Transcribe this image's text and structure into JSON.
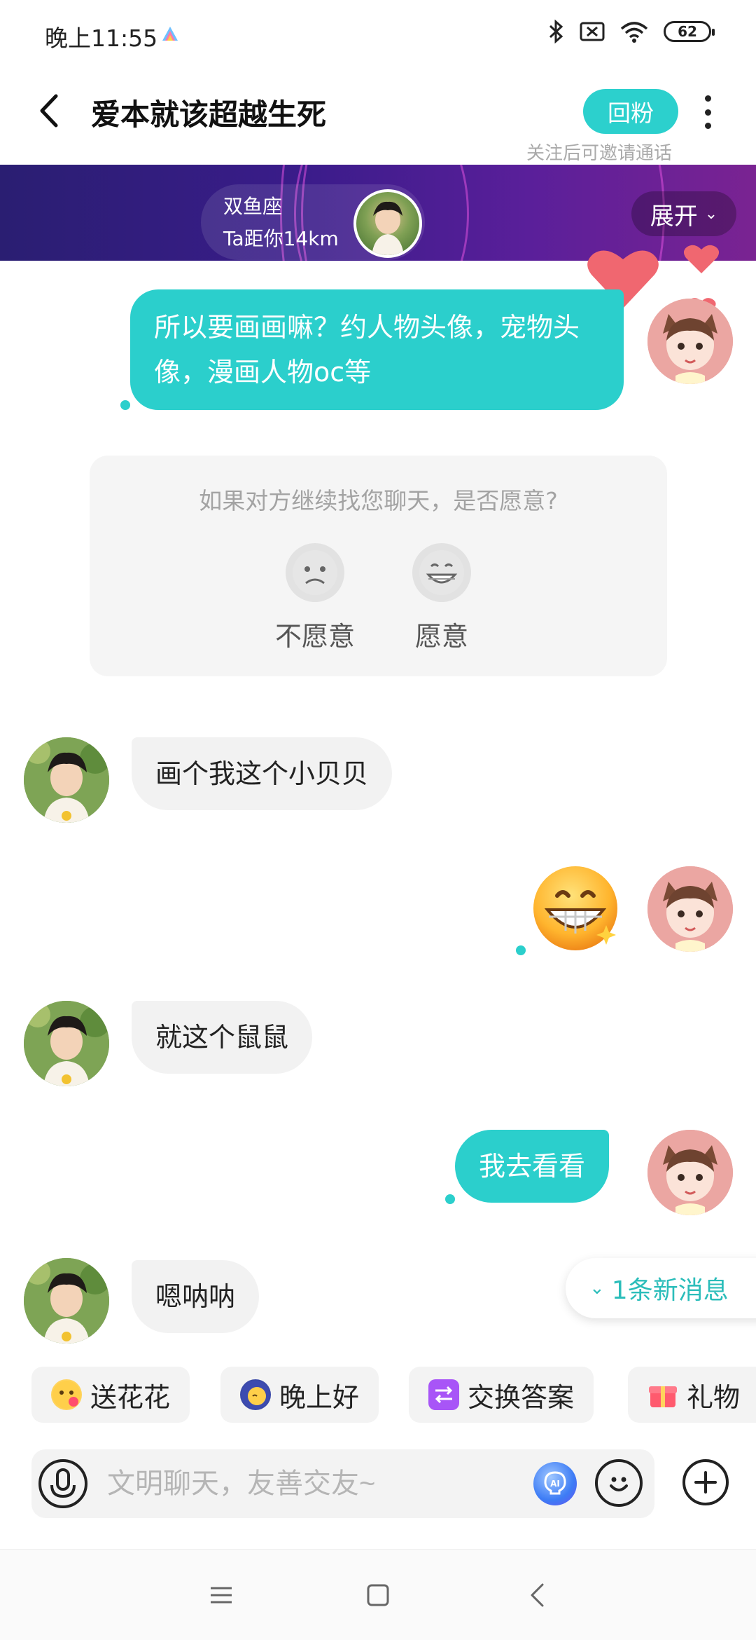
{
  "status_bar": {
    "time": "晚上11:55",
    "battery": "62",
    "icons": [
      "app-icon",
      "bluetooth-icon",
      "sim-icon",
      "wifi-icon",
      "battery-icon"
    ]
  },
  "header": {
    "title": "爱本就该超越生死",
    "follow_button": "回粉",
    "follow_hint": "关注后可邀请通话",
    "accent_color": "#2cd0cd"
  },
  "banner": {
    "sign": "双鱼座",
    "distance": "Ta距你14km",
    "expand_label": "展开"
  },
  "messages": [
    {
      "from": "me",
      "type": "text",
      "text": "所以要画画嘛？约人物头像，宠物头像，漫画人物oc等"
    },
    {
      "from": "other",
      "type": "text",
      "text": "画个我这个小贝贝"
    },
    {
      "from": "me",
      "type": "emoji",
      "text": "grinning-face-emoji"
    },
    {
      "from": "other",
      "type": "text",
      "text": "就这个鼠鼠"
    },
    {
      "from": "me",
      "type": "text",
      "text": "我去看看"
    },
    {
      "from": "other",
      "type": "text",
      "text": "嗯呐呐"
    }
  ],
  "survey": {
    "question": "如果对方继续找您聊天，是否愿意?",
    "options": [
      {
        "label": "不愿意",
        "icon": "sad-face-icon"
      },
      {
        "label": "愿意",
        "icon": "grinning-face-icon"
      }
    ]
  },
  "new_message_pill": "1条新消息",
  "quick_chips": [
    {
      "label": "送花花",
      "icon": "flower-face-icon"
    },
    {
      "label": "晚上好",
      "icon": "moon-face-icon"
    },
    {
      "label": "交换答案",
      "icon": "exchange-icon"
    },
    {
      "label": "礼物",
      "icon": "gift-icon"
    }
  ],
  "input": {
    "placeholder": "文明聊天，友善交友~"
  }
}
